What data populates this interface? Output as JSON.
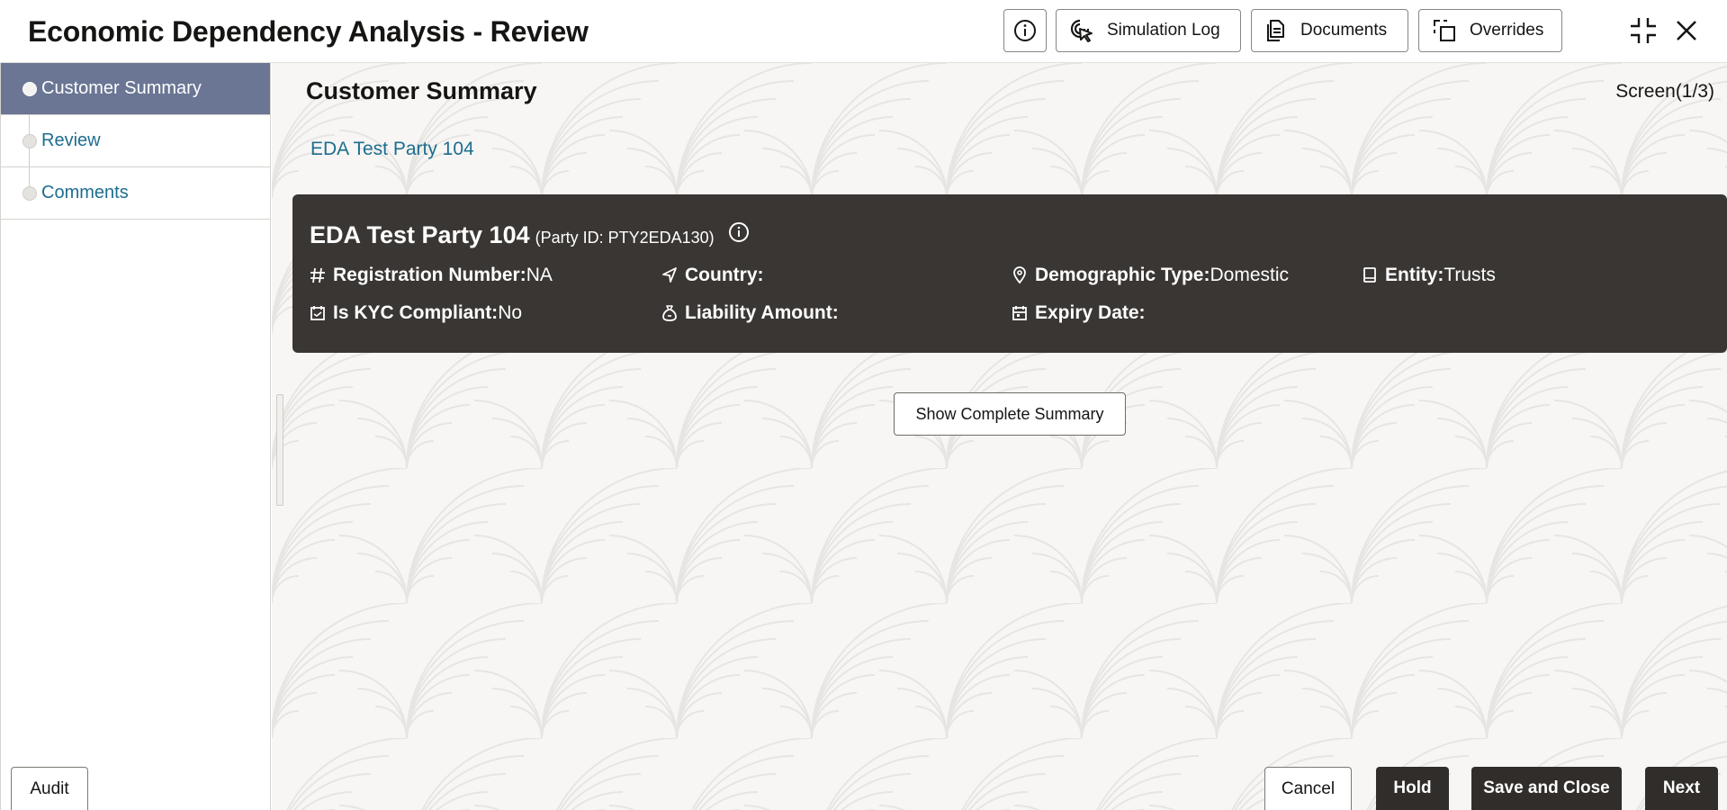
{
  "header": {
    "title": "Economic Dependency Analysis - Review",
    "info_icon": "info-icon",
    "simulation_log_label": "Simulation Log",
    "documents_label": "Documents",
    "overrides_label": "Overrides",
    "minimize_icon": "minimize-icon",
    "close_icon": "close-icon"
  },
  "sidebar": {
    "items": [
      {
        "label": "Customer Summary",
        "active": true
      },
      {
        "label": "Review",
        "active": false
      },
      {
        "label": "Comments",
        "active": false
      }
    ]
  },
  "main": {
    "title": "Customer Summary",
    "screen_indicator": "Screen(1/3)",
    "party_link": "EDA Test Party 104",
    "card": {
      "name": "EDA Test Party 104",
      "party_id": "(Party ID: PTY2EDA130)",
      "fields": {
        "registration_number": {
          "label": "Registration Number:",
          "value": "NA",
          "icon": "hash-icon"
        },
        "country": {
          "label": "Country:",
          "value": "",
          "icon": "navigation-icon"
        },
        "demographic_type": {
          "label": "Demographic Type:",
          "value": "Domestic",
          "icon": "location-pin-icon"
        },
        "entity": {
          "label": "Entity:",
          "value": "Trusts",
          "icon": "book-icon"
        },
        "kyc_compliant": {
          "label": "Is KYC Compliant:",
          "value": "No",
          "icon": "calendar-check-icon"
        },
        "liability_amount": {
          "label": "Liability Amount:",
          "value": "",
          "icon": "money-bag-icon"
        },
        "expiry_date": {
          "label": "Expiry Date:",
          "value": "",
          "icon": "calendar-icon"
        }
      }
    },
    "show_summary_label": "Show Complete Summary"
  },
  "footer": {
    "audit_label": "Audit",
    "cancel_label": "Cancel",
    "hold_label": "Hold",
    "save_close_label": "Save and Close",
    "next_label": "Next"
  },
  "colors": {
    "accent_link": "#1e6d8f",
    "sidebar_active": "#6a7694",
    "card_bg": "#3a3633",
    "dark_button": "#312d2a"
  }
}
